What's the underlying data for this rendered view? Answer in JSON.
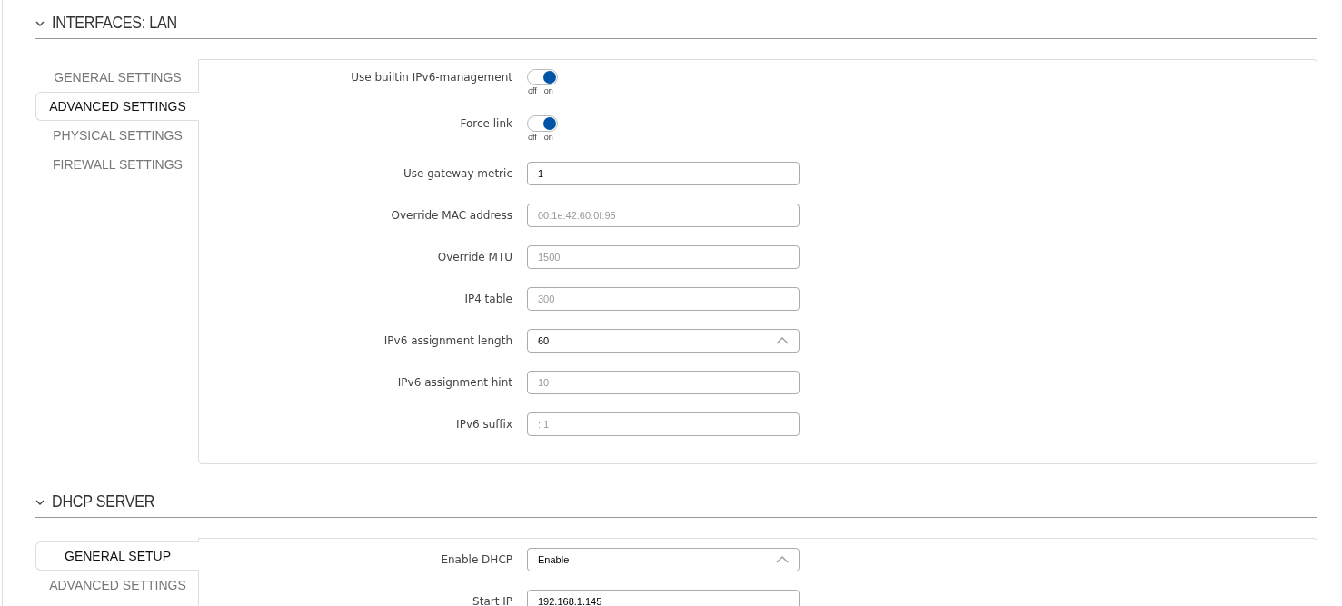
{
  "sections": [
    {
      "title": "INTERFACES: LAN",
      "expanded": true,
      "tabs": [
        {
          "label": "GENERAL SETTINGS",
          "selected": false
        },
        {
          "label": "ADVANCED SETTINGS",
          "selected": true
        },
        {
          "label": "PHYSICAL SETTINGS",
          "selected": false
        },
        {
          "label": "FIREWALL SETTINGS",
          "selected": false
        }
      ],
      "fields": [
        {
          "kind": "toggle",
          "label": "Use builtin IPv6-management",
          "on": true,
          "off_label": "off",
          "on_label": "on"
        },
        {
          "kind": "toggle",
          "label": "Force link",
          "on": true,
          "off_label": "off",
          "on_label": "on"
        },
        {
          "kind": "input",
          "label": "Use gateway metric",
          "value": "1"
        },
        {
          "kind": "input",
          "label": "Override MAC address",
          "placeholder": "00:1e:42:60:0f:95"
        },
        {
          "kind": "input",
          "label": "Override MTU",
          "placeholder": "1500"
        },
        {
          "kind": "input",
          "label": "IP4 table",
          "placeholder": "300"
        },
        {
          "kind": "select",
          "label": "IPv6 assignment length",
          "value": "60"
        },
        {
          "kind": "input",
          "label": "IPv6 assignment hint",
          "placeholder": "10"
        },
        {
          "kind": "input",
          "label": "IPv6 suffix",
          "placeholder": "::1"
        }
      ]
    },
    {
      "title": "DHCP SERVER",
      "expanded": true,
      "tabs": [
        {
          "label": "GENERAL SETUP",
          "selected": true
        },
        {
          "label": "ADVANCED SETTINGS",
          "selected": false
        }
      ],
      "fields": [
        {
          "kind": "select",
          "label": "Enable DHCP",
          "value": "Enable"
        },
        {
          "kind": "input",
          "label": "Start IP",
          "value": "192.168.1.145"
        }
      ]
    }
  ]
}
